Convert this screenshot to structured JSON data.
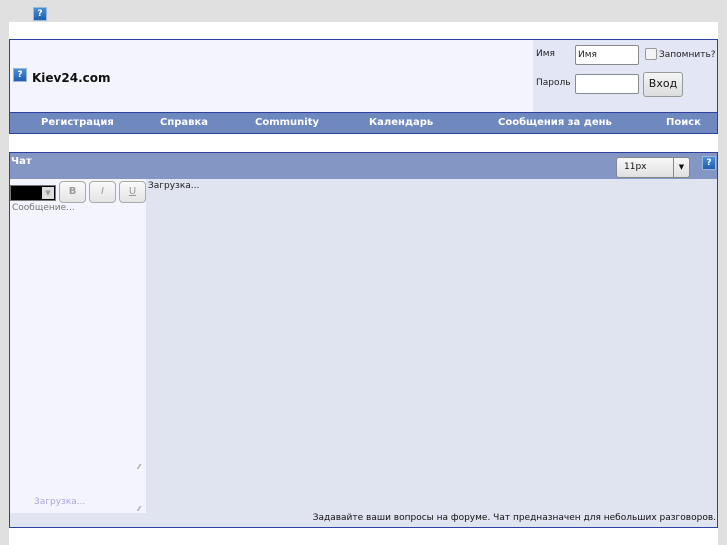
{
  "header": {
    "help_icon": "?",
    "site_title": "Kiev24.com"
  },
  "login": {
    "username_label": "Имя",
    "username_value": "Имя",
    "remember_label": "Запомнить?",
    "remember_checked": false,
    "password_label": "Пароль",
    "password_value": "",
    "submit_label": "Вход"
  },
  "nav": {
    "items": [
      {
        "label": "Регистрация"
      },
      {
        "label": "Справка"
      },
      {
        "label": "Community"
      },
      {
        "label": "Календарь"
      },
      {
        "label": "Сообщения за день"
      },
      {
        "label": "Поиск"
      }
    ]
  },
  "chat": {
    "title": "Чат",
    "font_size_selected": "11px",
    "help_icon": "?",
    "toolbar": {
      "color_selected": "#000000",
      "bold_label": "B",
      "italic_label": "I",
      "underline_label": "U"
    },
    "message_placeholder": "Сообщение...",
    "compose_loading": "Загрузка...",
    "messages_loading": "Загрузка...",
    "footer_note": "Задавайте ваши вопросы на форуме. Чат предназначен для небольших разговоров."
  }
}
